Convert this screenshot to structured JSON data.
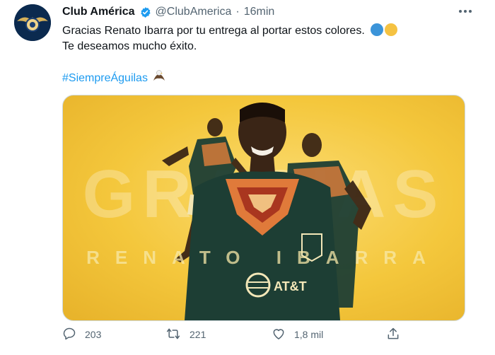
{
  "account": {
    "name": "Club América",
    "handle": "@ClubAmerica",
    "separator": "·",
    "time": "16min"
  },
  "tweet": {
    "line1": "Gracias Renato Ibarra por tu entrega al portar estos colores.",
    "line2": "Te deseamos mucho éxito.",
    "hashtag": "#SiempreÁguilas",
    "emoji_colors": [
      "#3b94d9",
      "#f5c242"
    ]
  },
  "media": {
    "headline": "GRACIAS",
    "player_name": "RENATO IBARRA",
    "sponsor": "AT&T",
    "colors": {
      "background": "#f4c73c",
      "jersey_dark": "#1d3e34",
      "jersey_pattern": "#e07a3a",
      "skin": "#3a2516"
    }
  },
  "actions": {
    "replies": "203",
    "retweets": "221",
    "likes": "1,8 mil"
  },
  "icons": [
    "verified-icon",
    "more-icon",
    "eagle-icon",
    "reply-icon",
    "retweet-icon",
    "like-icon",
    "share-icon"
  ]
}
